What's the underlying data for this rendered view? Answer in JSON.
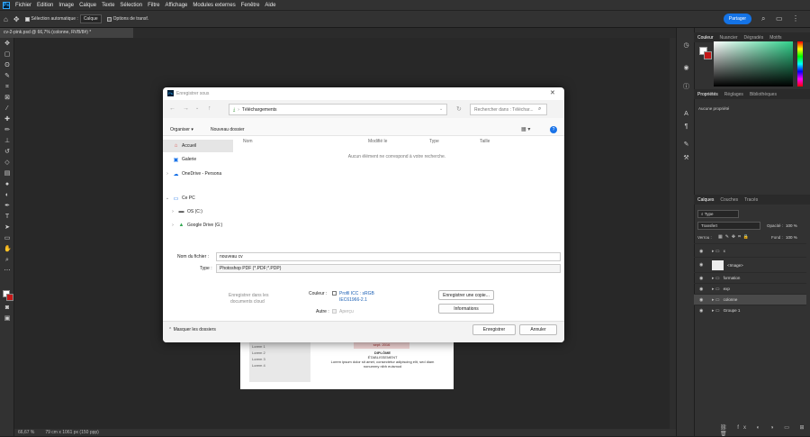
{
  "menubar": {
    "logo": "Ps",
    "items": [
      "Fichier",
      "Edition",
      "Image",
      "Calque",
      "Texte",
      "Sélection",
      "Filtre",
      "Affichage",
      "Modules externes",
      "Fenêtre",
      "Aide"
    ]
  },
  "optionsbar": {
    "auto_select_label": "Sélection automatique :",
    "auto_select_value": "Calque",
    "transform_label": "Options de transf."
  },
  "share_label": "Partager",
  "doc_tab": "cv-2-pink.psd @ 66,7% (colonne, RVB/8#) *",
  "status": {
    "zoom": "66,67 %",
    "size": "79 cm x 1061 px (150 ppp)"
  },
  "page": {
    "side_items": [
      "Lorem 1",
      "Lorem 2",
      "Lorem 3",
      "Lorem 4"
    ],
    "date": "sept. 2016",
    "title": "DIPLÔME",
    "subtitle": "ÉTABLISSEMENT",
    "text1": "Lorem ipsum dolor sit amet, consectetur adipiscing elit, sed diam",
    "text2": "nonummy nibh euismod"
  },
  "panels": {
    "color_tabs": [
      "Couleur",
      "Nuancier",
      "Dégradés",
      "Motifs"
    ],
    "props_tabs": [
      "Propriétés",
      "Réglages",
      "Bibliothèques"
    ],
    "props_text": "Aucune propriété",
    "layer_tabs": [
      "Calques",
      "Couches",
      "Tracés"
    ],
    "filter_label": "Type",
    "blend_mode": "Transfert",
    "opacity_label": "Opacité :",
    "opacity_value": "100 %",
    "lock_label": "Verrou :",
    "fill_label": "Fond :",
    "fill_value": "100 %",
    "layers": [
      {
        "name": "x",
        "kind": "folder"
      },
      {
        "name": "<Image>",
        "kind": "image"
      },
      {
        "name": "formation",
        "kind": "folder"
      },
      {
        "name": "exp",
        "kind": "folder"
      },
      {
        "name": "colonne",
        "kind": "folder",
        "selected": true
      },
      {
        "name": "Groupe 1",
        "kind": "folder"
      }
    ]
  },
  "dialog": {
    "title": "Enregistrer sous",
    "breadcrumb": "Téléchargements",
    "search_placeholder": "Rechercher dans : Téléchar...",
    "organize": "Organiser",
    "new_folder": "Nouveau dossier",
    "nav": [
      {
        "label": "Accueil",
        "icon": "home-icon",
        "selected": true
      },
      {
        "label": "Galerie",
        "icon": "gallery-icon"
      },
      {
        "label": "OneDrive - Persona",
        "icon": "cloud-icon"
      },
      {
        "label": "Ce PC",
        "icon": "pc-icon"
      },
      {
        "label": "OS (C:)",
        "icon": "drive-icon"
      },
      {
        "label": "Google Drive (G:)",
        "icon": "google-drive-icon"
      }
    ],
    "columns": [
      "Nom",
      "Modifié le",
      "Type",
      "Taille"
    ],
    "empty_text": "Aucun élément ne correspond à votre recherche.",
    "filename_label": "Nom du fichier :",
    "filename_value": "nouveau cv",
    "type_label": "Type :",
    "type_value": "Photoshop PDF (*.PDF;*.PDP)",
    "cloud_text1": "Enregistrer dans les",
    "cloud_text2": "documents cloud",
    "color_label": "Couleur :",
    "icc_label": "Profil ICC : sRGB",
    "icc_label2": "IEC61966-2.1",
    "other_label": "Autre :",
    "preview_label": "Aperçu",
    "save_copy": "Enregistrer une copie...",
    "info": "Informations",
    "hide_folders": "Masquer les dossiers",
    "save": "Enregistrer",
    "cancel": "Annuler"
  }
}
